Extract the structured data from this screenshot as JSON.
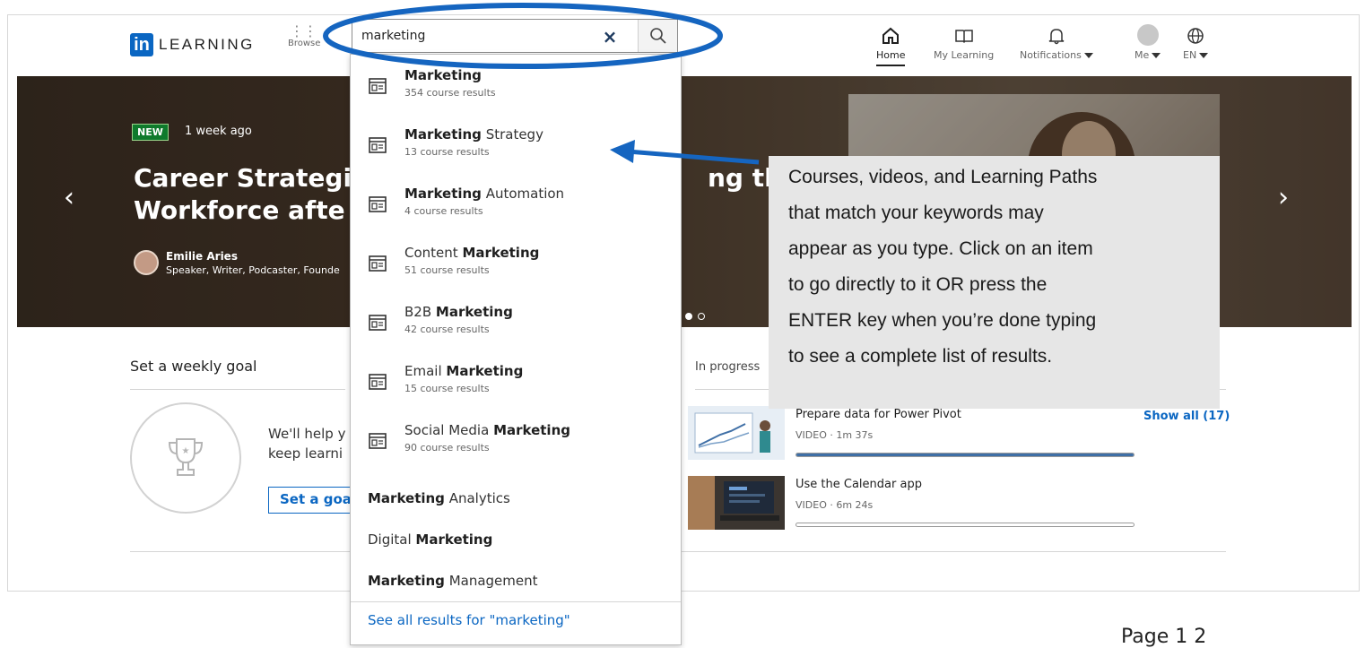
{
  "header": {
    "logo_text": "LEARNING",
    "logo_mark": "in",
    "browse_label": "Browse",
    "search_value": "marketing",
    "nav": [
      {
        "label": "Home",
        "icon": "home-icon",
        "active": true
      },
      {
        "label": "My Learning",
        "icon": "book-icon"
      },
      {
        "label": "Notifications",
        "icon": "bell-icon",
        "caret": true
      },
      {
        "label": "Me",
        "icon": "avatar",
        "caret": true
      },
      {
        "label": "EN",
        "icon": "globe-icon",
        "caret": true
      }
    ]
  },
  "hero": {
    "badge": "NEW",
    "posted": "1 week ago",
    "title_line1": "Career Strategie",
    "title_line2": "Workforce afte",
    "title_tail": "ng the",
    "author_name": "Emilie Aries",
    "author_role": "Speaker, Writer, Podcaster, Founde"
  },
  "dropdown": {
    "items": [
      {
        "bold": "Marketing",
        "rest": "",
        "sub": "354 course results"
      },
      {
        "bold": "Marketing",
        "rest": " Strategy",
        "sub": "13 course results"
      },
      {
        "bold": "Marketing",
        "rest": " Automation",
        "sub": "4 course results"
      },
      {
        "pre": "Content ",
        "bold": "Marketing",
        "sub": "51 course results"
      },
      {
        "pre": "B2B ",
        "bold": "Marketing",
        "sub": "42 course results"
      },
      {
        "pre": "Email ",
        "bold": "Marketing",
        "sub": "15 course results"
      },
      {
        "pre": "Social Media ",
        "bold": "Marketing",
        "sub": "90 course results"
      }
    ],
    "plain": [
      {
        "bold": "Marketing",
        "rest": " Analytics"
      },
      {
        "pre": "Digital ",
        "bold": "Marketing"
      },
      {
        "bold": "Marketing",
        "rest": " Management"
      }
    ],
    "see_all": "See all results for \"marketing\""
  },
  "goal": {
    "heading": "Set a weekly goal",
    "text_line1": "We'll help y",
    "text_line2": "keep learni",
    "button": "Set a goa"
  },
  "in_progress": {
    "tab": "In progress",
    "show_all": "Show all (17)",
    "courses": [
      {
        "title": "Prepare data for Power Pivot",
        "meta": "VIDEO · 1m 37s",
        "progress": 1.0
      },
      {
        "title": "Use the Calendar app",
        "meta": "VIDEO · 6m 24s",
        "progress": 0.0
      }
    ]
  },
  "callout": {
    "lines": [
      "Courses, videos, and Learning Paths",
      "that match your keywords may",
      "appear as you type. Click on an item",
      "to go directly to it OR press the",
      "ENTER key when you’re done typing",
      "to see a complete list of results."
    ]
  },
  "page_label": "Page 1 2",
  "colors": {
    "accent": "#0a66c2",
    "annotation": "#1565c0",
    "callout_bg": "#e6e6e6"
  }
}
